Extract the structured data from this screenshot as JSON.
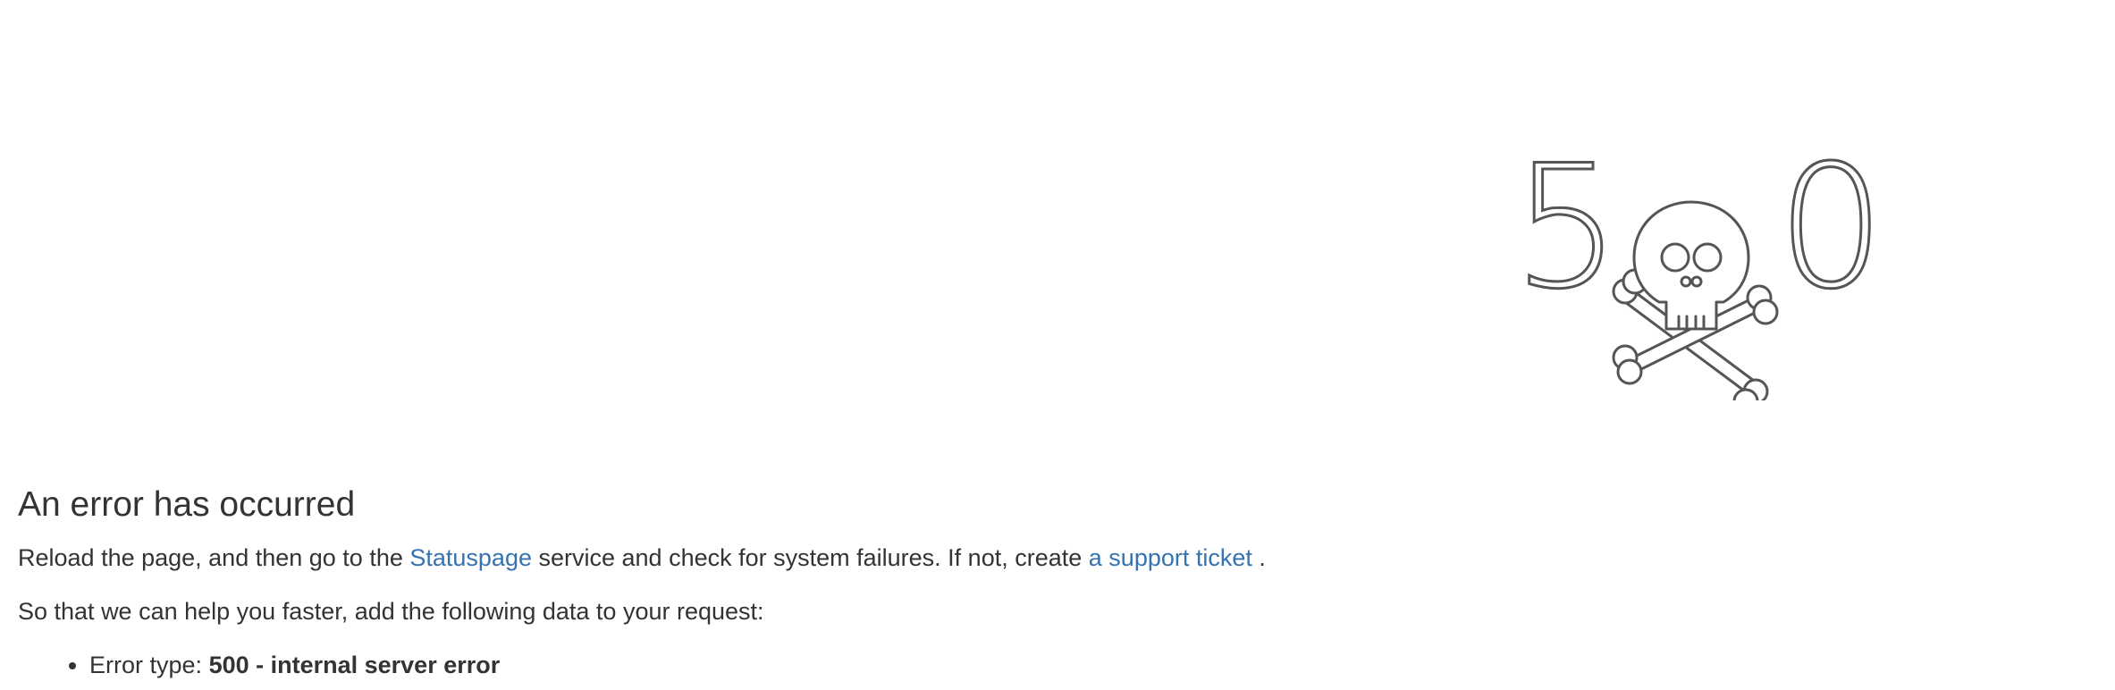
{
  "illustration": {
    "digit_left": "5",
    "digit_right": "0",
    "icon": "skull-crossbones-icon"
  },
  "error": {
    "title": "An error has occurred",
    "reload_text": "Reload the page, and then go to the",
    "statuspage_link": "Statuspage",
    "service_text": "service and check for system failures. If not, create",
    "support_link": "a support ticket",
    "period": ".",
    "help_text": "So that we can help you faster, add the following data to your request:",
    "details": [
      {
        "label": "Error type:",
        "value": "500 - internal server error"
      }
    ]
  },
  "colors": {
    "text": "#333333",
    "link": "#3572b0",
    "illustration_stroke": "#555555"
  }
}
